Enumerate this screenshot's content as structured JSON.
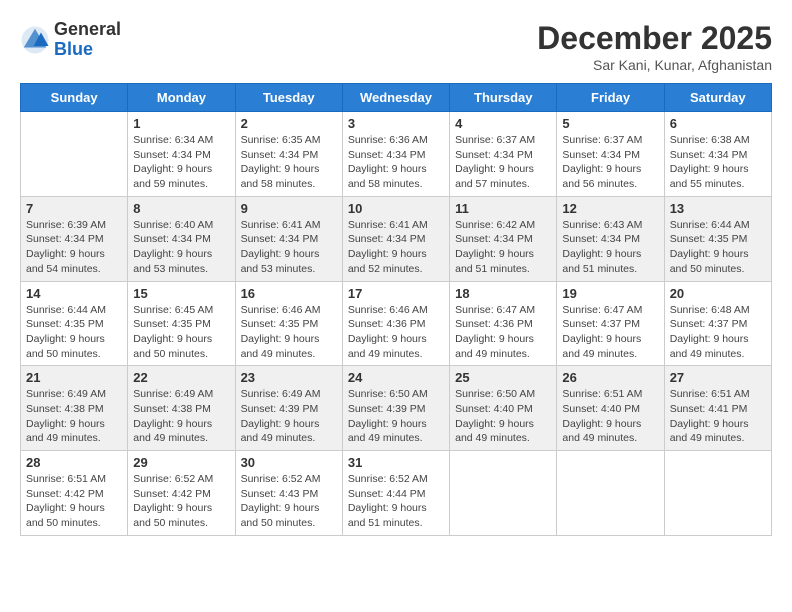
{
  "logo": {
    "general": "General",
    "blue": "Blue"
  },
  "title": "December 2025",
  "location": "Sar Kani, Kunar, Afghanistan",
  "days_of_week": [
    "Sunday",
    "Monday",
    "Tuesday",
    "Wednesday",
    "Thursday",
    "Friday",
    "Saturday"
  ],
  "weeks": [
    [
      {
        "day": "",
        "sunrise": "",
        "sunset": "",
        "daylight": ""
      },
      {
        "day": "1",
        "sunrise": "Sunrise: 6:34 AM",
        "sunset": "Sunset: 4:34 PM",
        "daylight": "Daylight: 9 hours and 59 minutes."
      },
      {
        "day": "2",
        "sunrise": "Sunrise: 6:35 AM",
        "sunset": "Sunset: 4:34 PM",
        "daylight": "Daylight: 9 hours and 58 minutes."
      },
      {
        "day": "3",
        "sunrise": "Sunrise: 6:36 AM",
        "sunset": "Sunset: 4:34 PM",
        "daylight": "Daylight: 9 hours and 58 minutes."
      },
      {
        "day": "4",
        "sunrise": "Sunrise: 6:37 AM",
        "sunset": "Sunset: 4:34 PM",
        "daylight": "Daylight: 9 hours and 57 minutes."
      },
      {
        "day": "5",
        "sunrise": "Sunrise: 6:37 AM",
        "sunset": "Sunset: 4:34 PM",
        "daylight": "Daylight: 9 hours and 56 minutes."
      },
      {
        "day": "6",
        "sunrise": "Sunrise: 6:38 AM",
        "sunset": "Sunset: 4:34 PM",
        "daylight": "Daylight: 9 hours and 55 minutes."
      }
    ],
    [
      {
        "day": "7",
        "sunrise": "Sunrise: 6:39 AM",
        "sunset": "Sunset: 4:34 PM",
        "daylight": "Daylight: 9 hours and 54 minutes."
      },
      {
        "day": "8",
        "sunrise": "Sunrise: 6:40 AM",
        "sunset": "Sunset: 4:34 PM",
        "daylight": "Daylight: 9 hours and 53 minutes."
      },
      {
        "day": "9",
        "sunrise": "Sunrise: 6:41 AM",
        "sunset": "Sunset: 4:34 PM",
        "daylight": "Daylight: 9 hours and 53 minutes."
      },
      {
        "day": "10",
        "sunrise": "Sunrise: 6:41 AM",
        "sunset": "Sunset: 4:34 PM",
        "daylight": "Daylight: 9 hours and 52 minutes."
      },
      {
        "day": "11",
        "sunrise": "Sunrise: 6:42 AM",
        "sunset": "Sunset: 4:34 PM",
        "daylight": "Daylight: 9 hours and 51 minutes."
      },
      {
        "day": "12",
        "sunrise": "Sunrise: 6:43 AM",
        "sunset": "Sunset: 4:34 PM",
        "daylight": "Daylight: 9 hours and 51 minutes."
      },
      {
        "day": "13",
        "sunrise": "Sunrise: 6:44 AM",
        "sunset": "Sunset: 4:35 PM",
        "daylight": "Daylight: 9 hours and 50 minutes."
      }
    ],
    [
      {
        "day": "14",
        "sunrise": "Sunrise: 6:44 AM",
        "sunset": "Sunset: 4:35 PM",
        "daylight": "Daylight: 9 hours and 50 minutes."
      },
      {
        "day": "15",
        "sunrise": "Sunrise: 6:45 AM",
        "sunset": "Sunset: 4:35 PM",
        "daylight": "Daylight: 9 hours and 50 minutes."
      },
      {
        "day": "16",
        "sunrise": "Sunrise: 6:46 AM",
        "sunset": "Sunset: 4:35 PM",
        "daylight": "Daylight: 9 hours and 49 minutes."
      },
      {
        "day": "17",
        "sunrise": "Sunrise: 6:46 AM",
        "sunset": "Sunset: 4:36 PM",
        "daylight": "Daylight: 9 hours and 49 minutes."
      },
      {
        "day": "18",
        "sunrise": "Sunrise: 6:47 AM",
        "sunset": "Sunset: 4:36 PM",
        "daylight": "Daylight: 9 hours and 49 minutes."
      },
      {
        "day": "19",
        "sunrise": "Sunrise: 6:47 AM",
        "sunset": "Sunset: 4:37 PM",
        "daylight": "Daylight: 9 hours and 49 minutes."
      },
      {
        "day": "20",
        "sunrise": "Sunrise: 6:48 AM",
        "sunset": "Sunset: 4:37 PM",
        "daylight": "Daylight: 9 hours and 49 minutes."
      }
    ],
    [
      {
        "day": "21",
        "sunrise": "Sunrise: 6:49 AM",
        "sunset": "Sunset: 4:38 PM",
        "daylight": "Daylight: 9 hours and 49 minutes."
      },
      {
        "day": "22",
        "sunrise": "Sunrise: 6:49 AM",
        "sunset": "Sunset: 4:38 PM",
        "daylight": "Daylight: 9 hours and 49 minutes."
      },
      {
        "day": "23",
        "sunrise": "Sunrise: 6:49 AM",
        "sunset": "Sunset: 4:39 PM",
        "daylight": "Daylight: 9 hours and 49 minutes."
      },
      {
        "day": "24",
        "sunrise": "Sunrise: 6:50 AM",
        "sunset": "Sunset: 4:39 PM",
        "daylight": "Daylight: 9 hours and 49 minutes."
      },
      {
        "day": "25",
        "sunrise": "Sunrise: 6:50 AM",
        "sunset": "Sunset: 4:40 PM",
        "daylight": "Daylight: 9 hours and 49 minutes."
      },
      {
        "day": "26",
        "sunrise": "Sunrise: 6:51 AM",
        "sunset": "Sunset: 4:40 PM",
        "daylight": "Daylight: 9 hours and 49 minutes."
      },
      {
        "day": "27",
        "sunrise": "Sunrise: 6:51 AM",
        "sunset": "Sunset: 4:41 PM",
        "daylight": "Daylight: 9 hours and 49 minutes."
      }
    ],
    [
      {
        "day": "28",
        "sunrise": "Sunrise: 6:51 AM",
        "sunset": "Sunset: 4:42 PM",
        "daylight": "Daylight: 9 hours and 50 minutes."
      },
      {
        "day": "29",
        "sunrise": "Sunrise: 6:52 AM",
        "sunset": "Sunset: 4:42 PM",
        "daylight": "Daylight: 9 hours and 50 minutes."
      },
      {
        "day": "30",
        "sunrise": "Sunrise: 6:52 AM",
        "sunset": "Sunset: 4:43 PM",
        "daylight": "Daylight: 9 hours and 50 minutes."
      },
      {
        "day": "31",
        "sunrise": "Sunrise: 6:52 AM",
        "sunset": "Sunset: 4:44 PM",
        "daylight": "Daylight: 9 hours and 51 minutes."
      },
      {
        "day": "",
        "sunrise": "",
        "sunset": "",
        "daylight": ""
      },
      {
        "day": "",
        "sunrise": "",
        "sunset": "",
        "daylight": ""
      },
      {
        "day": "",
        "sunrise": "",
        "sunset": "",
        "daylight": ""
      }
    ]
  ]
}
